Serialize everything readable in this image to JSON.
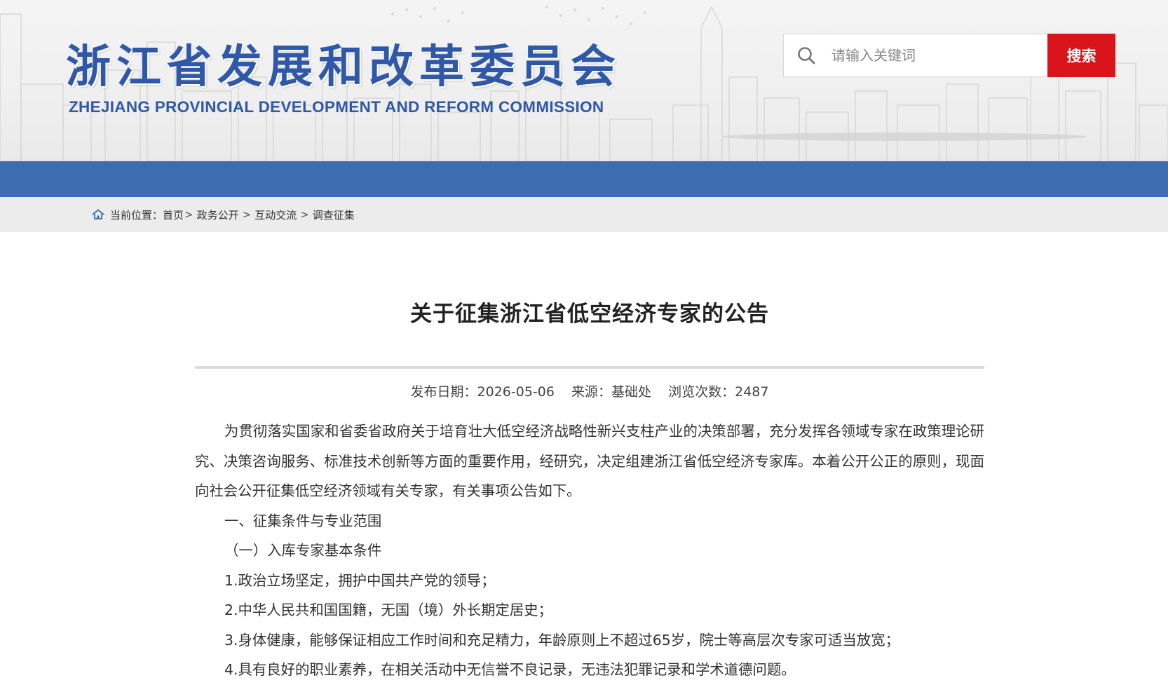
{
  "header": {
    "logo_cn": "浙江省发展和改革委员会",
    "logo_en": "ZHEJIANG PROVINCIAL DEVELOPMENT AND REFORM COMMISSION",
    "search": {
      "placeholder": "请输入关键词",
      "button_label": "搜索",
      "icon": "search-icon"
    }
  },
  "breadcrumb": {
    "prefix": "当前位置：",
    "items": [
      "首页",
      "政务公开",
      "互动交流",
      "调查征集"
    ],
    "separator": ">"
  },
  "article": {
    "title": "关于征集浙江省低空经济专家的公告",
    "meta": {
      "date_label": "发布日期：",
      "date": "2026-05-06",
      "source_label": "来源：",
      "source": "基础处",
      "views_label": "浏览次数：",
      "views": "2487"
    },
    "paragraphs": [
      "为贯彻落实国家和省委省政府关于培育壮大低空经济战略性新兴支柱产业的决策部署，充分发挥各领域专家在政策理论研究、决策咨询服务、标准技术创新等方面的重要作用，经研究，决定组建浙江省低空经济专家库。本着公开公正的原则，现面向社会公开征集低空经济领域有关专家，有关事项公告如下。",
      "一、征集条件与专业范围",
      "（一）入库专家基本条件",
      "1.政治立场坚定，拥护中国共产党的领导；",
      "2.中华人民共和国国籍，无国（境）外长期定居史；",
      "3.身体健康，能够保证相应工作时间和充足精力，年龄原则上不超过65岁，院士等高层次专家可适当放宽；",
      "4.具有良好的职业素养，在相关活动中无信誉不良记录，无违法犯罪记录和学术道德问题。"
    ]
  },
  "colors": {
    "brand_blue": "#2f58a8",
    "nav_blue": "#3d6db0",
    "search_red": "#d9141b",
    "breadcrumb_bg": "#ececec"
  }
}
